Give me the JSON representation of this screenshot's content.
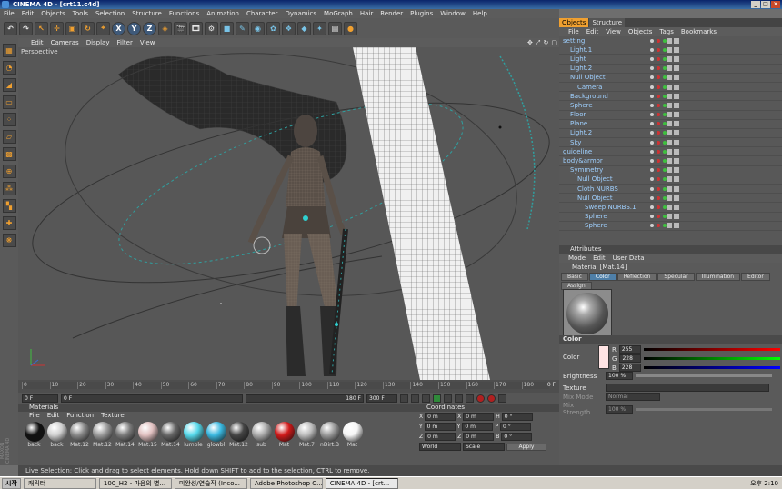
{
  "window": {
    "title": "CINEMA 4D - [crt11.c4d]"
  },
  "menu": [
    "File",
    "Edit",
    "Objects",
    "Tools",
    "Selection",
    "Structure",
    "Functions",
    "Animation",
    "Character",
    "Dynamics",
    "MoGraph",
    "Hair",
    "Render",
    "Plugins",
    "Window",
    "Help"
  ],
  "viewport": {
    "menu": [
      "Edit",
      "Cameras",
      "Display",
      "Filter",
      "View"
    ],
    "label": "Perspective"
  },
  "timeline": {
    "ticks": [
      "0",
      "10",
      "20",
      "30",
      "40",
      "50",
      "60",
      "70",
      "80",
      "90",
      "100",
      "110",
      "120",
      "130",
      "140",
      "150",
      "160",
      "170",
      "180"
    ],
    "end_label": "0 F",
    "start_field": "0 F",
    "min_field": "0 F",
    "max_field": "180 F",
    "end_field": "300 F"
  },
  "materials": {
    "title": "Materials",
    "menu": [
      "File",
      "Edit",
      "Function",
      "Texture"
    ],
    "items": [
      {
        "name": "back",
        "color": "#111"
      },
      {
        "name": "back",
        "color": "#cfcfcf"
      },
      {
        "name": "Mat.12",
        "color": "#888"
      },
      {
        "name": "Mat.12",
        "color": "#999"
      },
      {
        "name": "Mat.14",
        "color": "#7a7a7a"
      },
      {
        "name": "Mat.15",
        "color": "#e0c0c0"
      },
      {
        "name": "Mat.14",
        "color": "#666"
      },
      {
        "name": "lumble",
        "color": "#55d8ea"
      },
      {
        "name": "glowbl",
        "color": "#3ab8e0"
      },
      {
        "name": "Mat.12",
        "color": "#444"
      },
      {
        "name": "sub",
        "color": "#aaa"
      },
      {
        "name": "Mat",
        "color": "#d01818"
      },
      {
        "name": "Mat.7",
        "color": "#bbb"
      },
      {
        "name": "nDirt.B",
        "color": "#999"
      },
      {
        "name": "Mat",
        "color": "#f5f5f5"
      }
    ]
  },
  "coordinates": {
    "title": "Coordinates",
    "rows": [
      {
        "a": "X",
        "av": "0 m",
        "b": "X",
        "bv": "0 m",
        "c": "H",
        "cv": "0 °"
      },
      {
        "a": "Y",
        "av": "0 m",
        "b": "Y",
        "bv": "0 m",
        "c": "P",
        "cv": "0 °"
      },
      {
        "a": "Z",
        "av": "0 m",
        "b": "Z",
        "bv": "0 m",
        "c": "B",
        "cv": "0 °"
      }
    ],
    "mode1": "World",
    "mode2": "Scale",
    "apply": "Apply"
  },
  "objects": {
    "tabs": [
      "Objects",
      "Structure"
    ],
    "menu": [
      "File",
      "Edit",
      "View",
      "Objects",
      "Tags",
      "Bookmarks"
    ],
    "items": [
      {
        "name": "setting",
        "indent": 0
      },
      {
        "name": "Light.1",
        "indent": 1
      },
      {
        "name": "Light",
        "indent": 1
      },
      {
        "name": "Light.2",
        "indent": 1
      },
      {
        "name": "Null Object",
        "indent": 1
      },
      {
        "name": "Camera",
        "indent": 2
      },
      {
        "name": "Background",
        "indent": 1
      },
      {
        "name": "Sphere",
        "indent": 1
      },
      {
        "name": "Floor",
        "indent": 1
      },
      {
        "name": "Plane",
        "indent": 1
      },
      {
        "name": "Light.2",
        "indent": 1
      },
      {
        "name": "Sky",
        "indent": 1
      },
      {
        "name": "guideline",
        "indent": 0
      },
      {
        "name": "body&armor",
        "indent": 0
      },
      {
        "name": "Symmetry",
        "indent": 1
      },
      {
        "name": "Null Object",
        "indent": 2
      },
      {
        "name": "Cloth NURBS",
        "indent": 2
      },
      {
        "name": "Null Object",
        "indent": 2
      },
      {
        "name": "Sweep NURBS.1",
        "indent": 3
      },
      {
        "name": "Sphere",
        "indent": 3
      },
      {
        "name": "Sphere",
        "indent": 3
      }
    ]
  },
  "attributes": {
    "title": "Attributes",
    "menu": [
      "Mode",
      "Edit",
      "User Data"
    ],
    "material_name": "Material [Mat.14]",
    "tabs": [
      "Basic",
      "Color",
      "Reflection",
      "Specular",
      "Illumination",
      "Editor",
      "Assign"
    ],
    "active_tab": "Color",
    "section": "Color",
    "color_label": "Color",
    "r": "255",
    "g": "228",
    "b": "228",
    "brightness_label": "Brightness",
    "brightness": "100 %",
    "texture_label": "Texture",
    "mix_mode_label": "Mix Mode",
    "mix_mode": "Normal",
    "mix_strength_label": "Mix Strength",
    "mix_strength": "100 %"
  },
  "status": "Live Selection: Click and drag to select elements. Hold down SHIFT to add to the selection, CTRL to remove.",
  "taskbar": {
    "start": "시작",
    "tasks": [
      "캐릭터",
      "100_H2 - 마음의 별...",
      "미완성/연습작 (Inco...",
      "Adobe Photoshop C...",
      "CINEMA 4D - [crt..."
    ],
    "clock": "오후 2:10"
  }
}
